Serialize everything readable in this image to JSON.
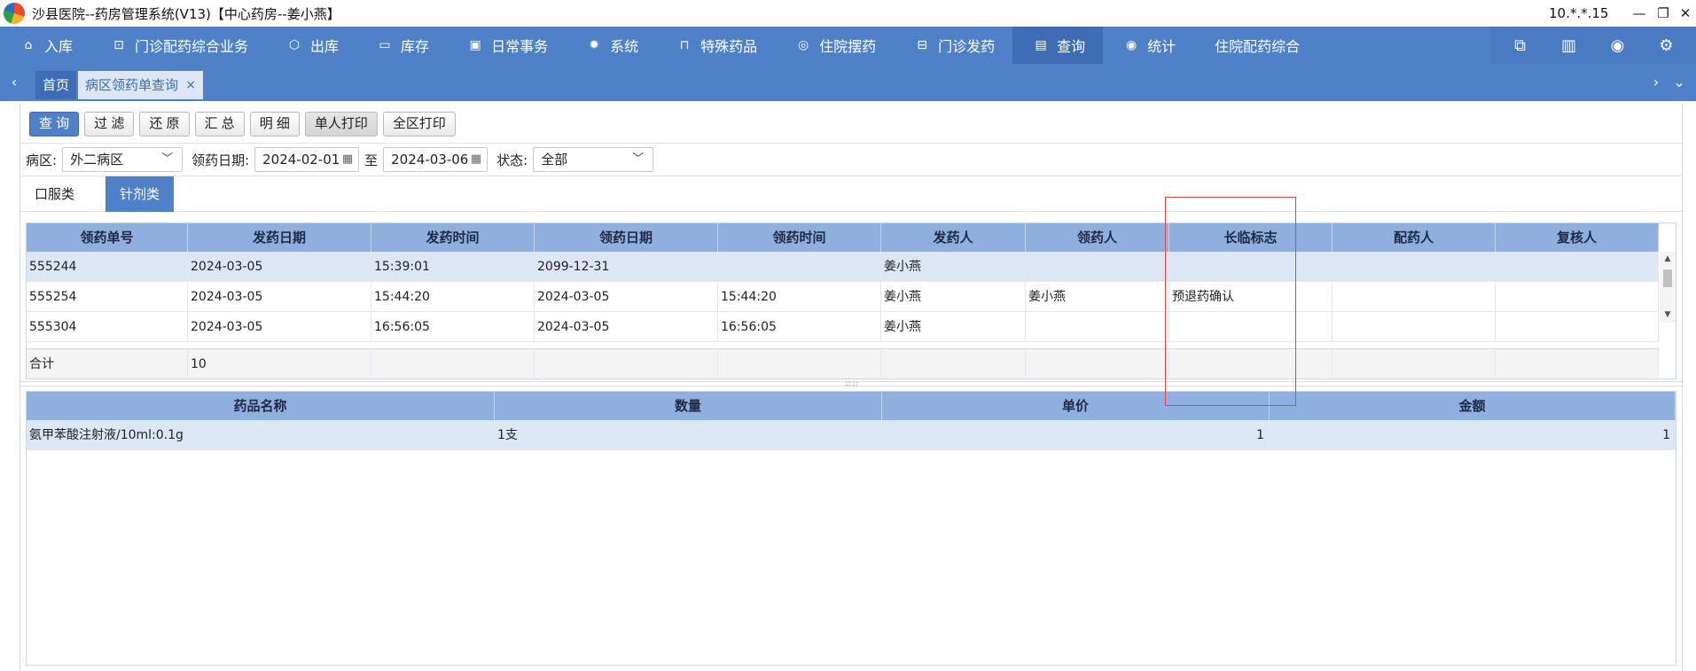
{
  "window": {
    "title": "沙县医院--药房管理系统(V13)【中心药房--姜小燕】",
    "ip": "10.*.*.15",
    "minimize": "—",
    "restore": "❐",
    "close": "✕"
  },
  "main_nav": [
    {
      "label": "入库",
      "icon": "house-icon",
      "glyph": "⌂"
    },
    {
      "label": "门诊配药综合业务",
      "icon": "lock-icon",
      "glyph": "⊡"
    },
    {
      "label": "出库",
      "icon": "box-icon",
      "glyph": "⬡"
    },
    {
      "label": "库存",
      "icon": "inventory-icon",
      "glyph": "▭"
    },
    {
      "label": "日常事务",
      "icon": "calendar-icon",
      "glyph": "▣"
    },
    {
      "label": "系统",
      "icon": "gear-icon",
      "glyph": "✹"
    },
    {
      "label": "特殊药品",
      "icon": "bottle-icon",
      "glyph": "⊓"
    },
    {
      "label": "住院摆药",
      "icon": "search-icon",
      "glyph": "◎"
    },
    {
      "label": "门诊发药",
      "icon": "pill-bottle-icon",
      "glyph": "⊟"
    },
    {
      "label": "查询",
      "icon": "query-icon",
      "glyph": "▤",
      "active": true
    },
    {
      "label": "统计",
      "icon": "chart-icon",
      "glyph": "◉"
    },
    {
      "label": "住院配药综合",
      "icon": "",
      "glyph": ""
    }
  ],
  "nav_right_icons": [
    {
      "name": "message-icon",
      "glyph": "⧉"
    },
    {
      "name": "document-icon",
      "glyph": "▥"
    },
    {
      "name": "eye-icon",
      "glyph": "◉"
    },
    {
      "name": "settings-icon",
      "glyph": "⚙"
    }
  ],
  "tabs": {
    "prev": "‹",
    "next": "›",
    "dropdown": "⌄",
    "home": "首页",
    "current": "病区领药单查询",
    "close": "×"
  },
  "toolbar": {
    "query": "查 询",
    "filter": "过 滤",
    "restore": "还 原",
    "summary": "汇 总",
    "detail": "明 细",
    "single_print": "单人打印",
    "ward_print": "全区打印"
  },
  "filters": {
    "ward_label": "病区:",
    "ward_value": "外二病区",
    "date_label": "领药日期:",
    "date_from": "2024-02-01",
    "date_sep": "至",
    "date_to": "2024-03-06",
    "status_label": "状态:",
    "status_value": "全部"
  },
  "subtabs": [
    "口服类",
    "针剂类"
  ],
  "upper_grid": {
    "headers": [
      "领药单号",
      "发药日期",
      "发药时间",
      "领药日期",
      "领药时间",
      "发药人",
      "领药人",
      "长临标志",
      "配药人",
      "复核人"
    ],
    "rows": [
      [
        "555244",
        "2024-03-05",
        "15:39:01",
        "2099-12-31",
        "",
        "姜小燕",
        "",
        "",
        "",
        ""
      ],
      [
        "555254",
        "2024-03-05",
        "15:44:20",
        "2024-03-05",
        "15:44:20",
        "姜小燕",
        "姜小燕",
        "预退药确认",
        "",
        ""
      ],
      [
        "555304",
        "2024-03-05",
        "16:56:05",
        "2024-03-05",
        "16:56:05",
        "姜小燕",
        "",
        "",
        "",
        ""
      ]
    ],
    "footer": [
      "合计",
      "10",
      "",
      "",
      "",
      "",
      "",
      "",
      "",
      ""
    ]
  },
  "lower_grid": {
    "headers": [
      "药品名称",
      "数量",
      "单价",
      "金额"
    ],
    "rows": [
      [
        "氨甲苯酸注射液/10ml:0.1g",
        "1支",
        "1",
        "1"
      ]
    ]
  },
  "colors": {
    "nav_bg": "#4f81c9",
    "nav_active": "#3e6db5",
    "grid_header": "#8fb0de",
    "row_selected": "#dde6f4",
    "highlight_box": "#e04545"
  }
}
